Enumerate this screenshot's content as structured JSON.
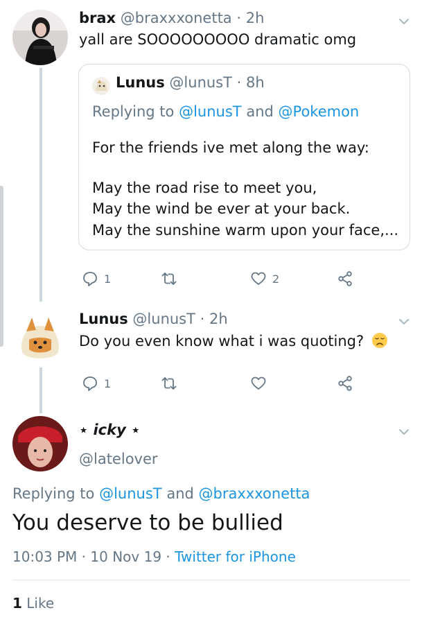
{
  "tweet1": {
    "name": "brax",
    "handle": "@braxxxonetta",
    "time": "2h",
    "text": "yall are SOOOOOOOOO dramatic omg",
    "quote": {
      "name": "Lunus",
      "handle": "@lunusT",
      "time": "8h",
      "replying_prefix": "Replying to",
      "replying_user1": "@lunusT",
      "replying_and": "and",
      "replying_user2": "@Pokemon",
      "lines": [
        "For the friends ive met along the way:",
        "May the road rise to meet you,",
        "May the wind be ever at your back.",
        "May the sunshine warm upon your face,..."
      ]
    },
    "reply_count": "1",
    "retweet_count": "",
    "like_count": "2"
  },
  "tweet2": {
    "name": "Lunus",
    "handle": "@lunusT",
    "time": "2h",
    "text": "Do you even know what i was quoting?",
    "emoji": "😞",
    "reply_count": "1",
    "retweet_count": "",
    "like_count": ""
  },
  "focal": {
    "name": "⋆ icky ⋆",
    "handle": "@latelover",
    "replying_prefix": "Replying to",
    "replying_user1": "@lunusT",
    "replying_and": "and",
    "replying_user2": "@braxxxonetta",
    "text": "You deserve to be bullied",
    "time": "10:03 PM",
    "date": "10 Nov 19",
    "source": "Twitter for iPhone",
    "like_count": "1",
    "like_label": "Like"
  },
  "separator": "·",
  "icons": {
    "reply": "reply-icon",
    "retweet": "retweet-icon",
    "like": "heart-icon",
    "share": "share-icon",
    "more": "chevron-down-icon"
  },
  "colors": {
    "link": "#1b95e0",
    "secondary_text": "#657786",
    "thread_line": "#ccd6dd"
  }
}
